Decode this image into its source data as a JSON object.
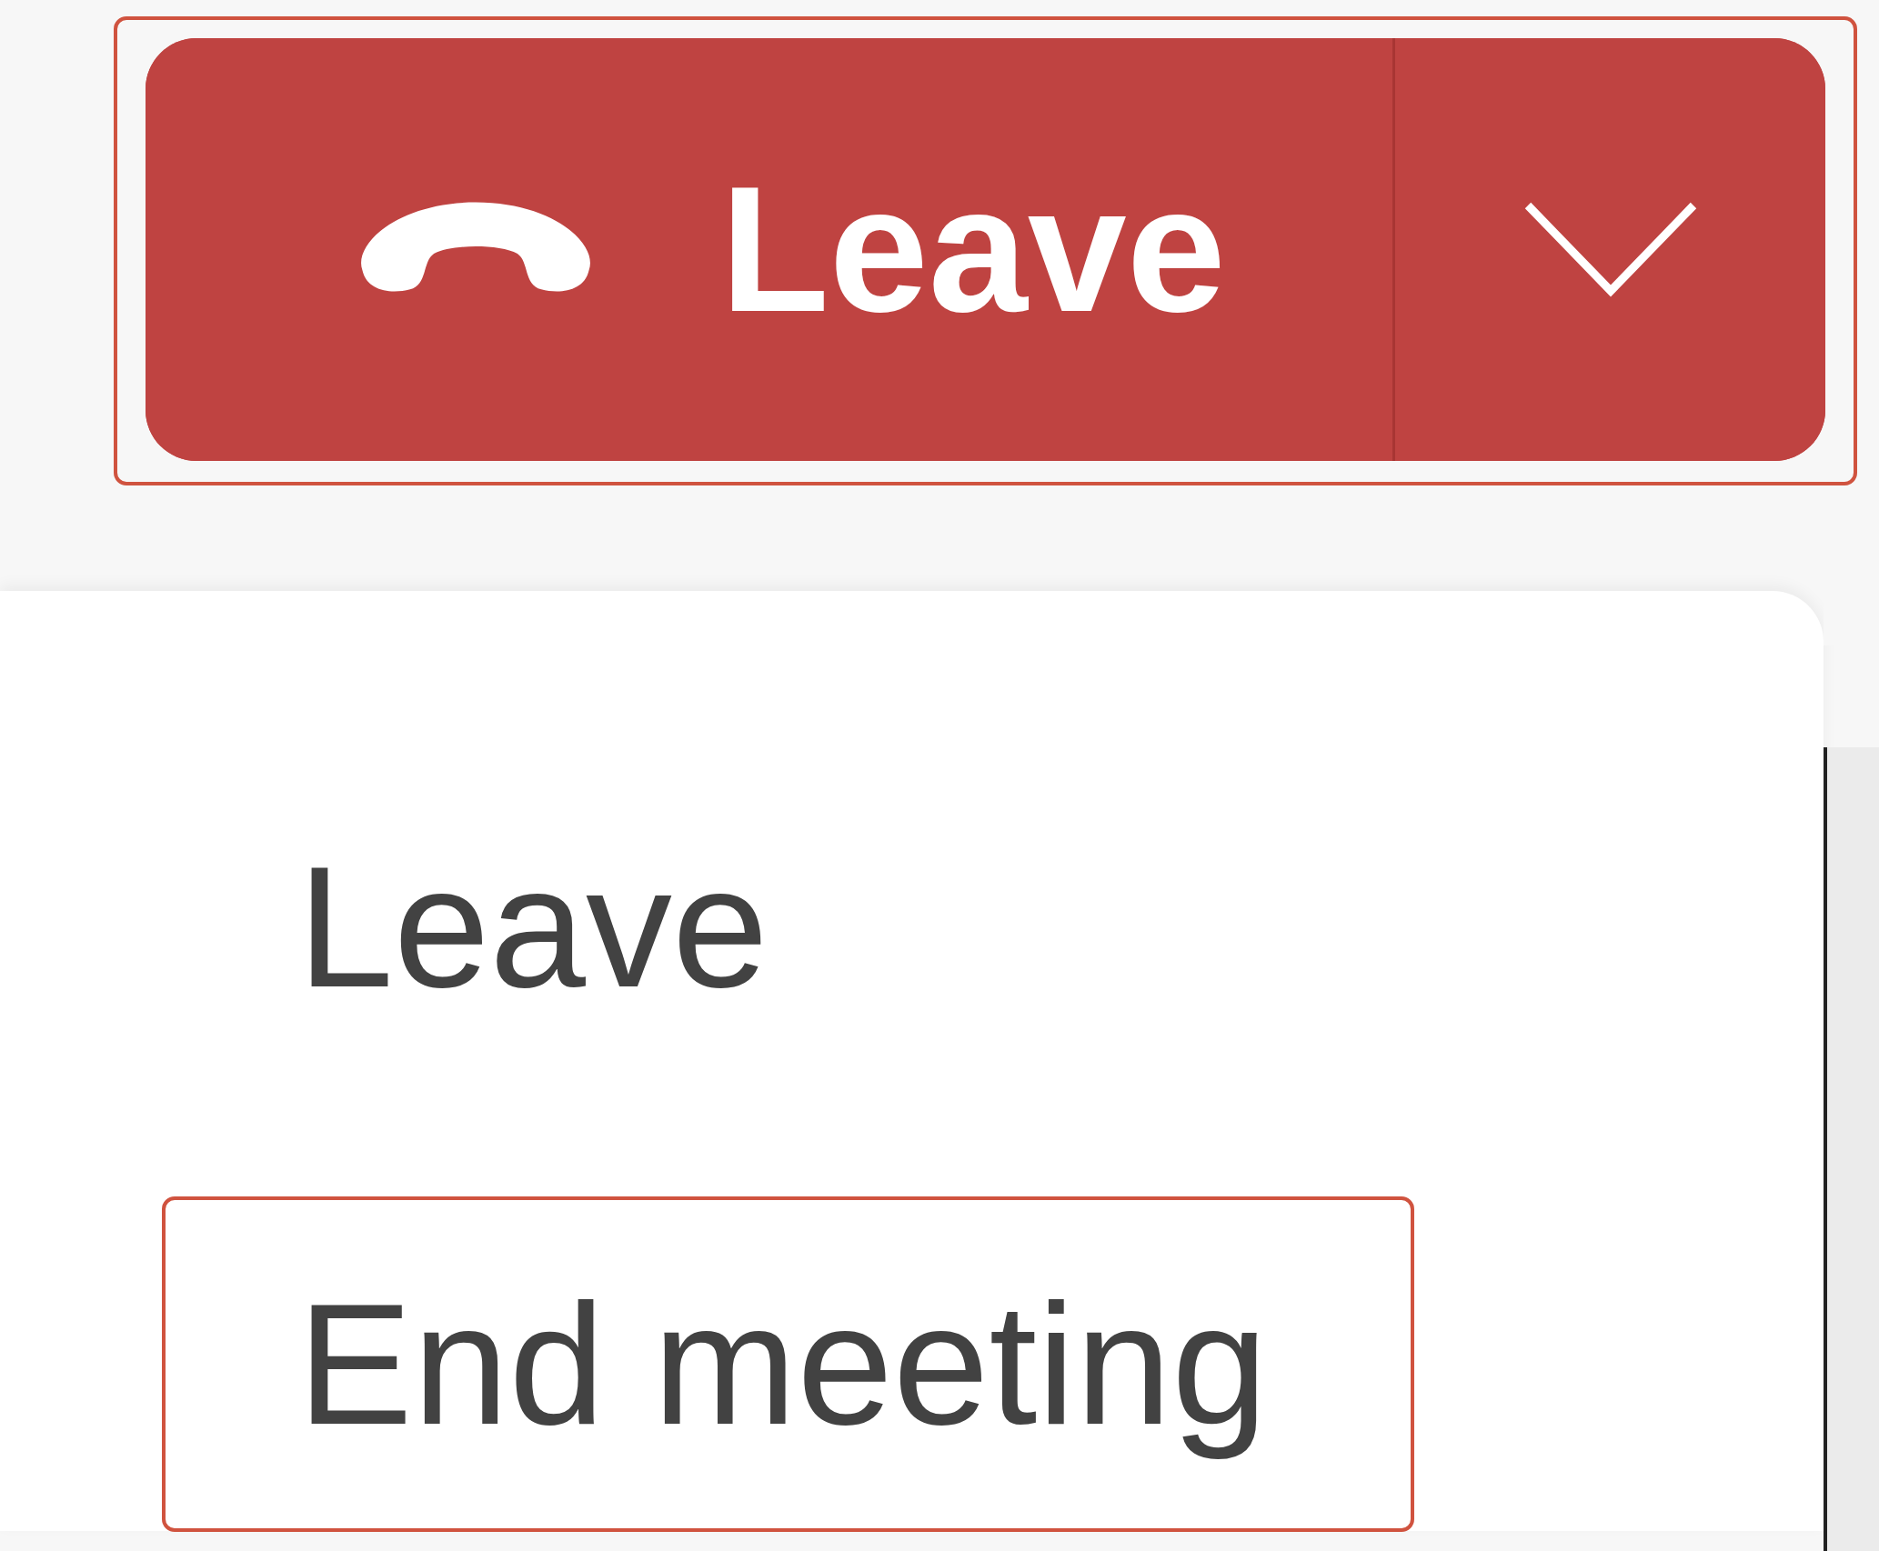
{
  "split_button": {
    "label": "Leave",
    "highlighted": true
  },
  "menu": {
    "items": [
      {
        "label": "Leave",
        "highlighted": false
      },
      {
        "label": "End meeting",
        "highlighted": true
      }
    ]
  }
}
